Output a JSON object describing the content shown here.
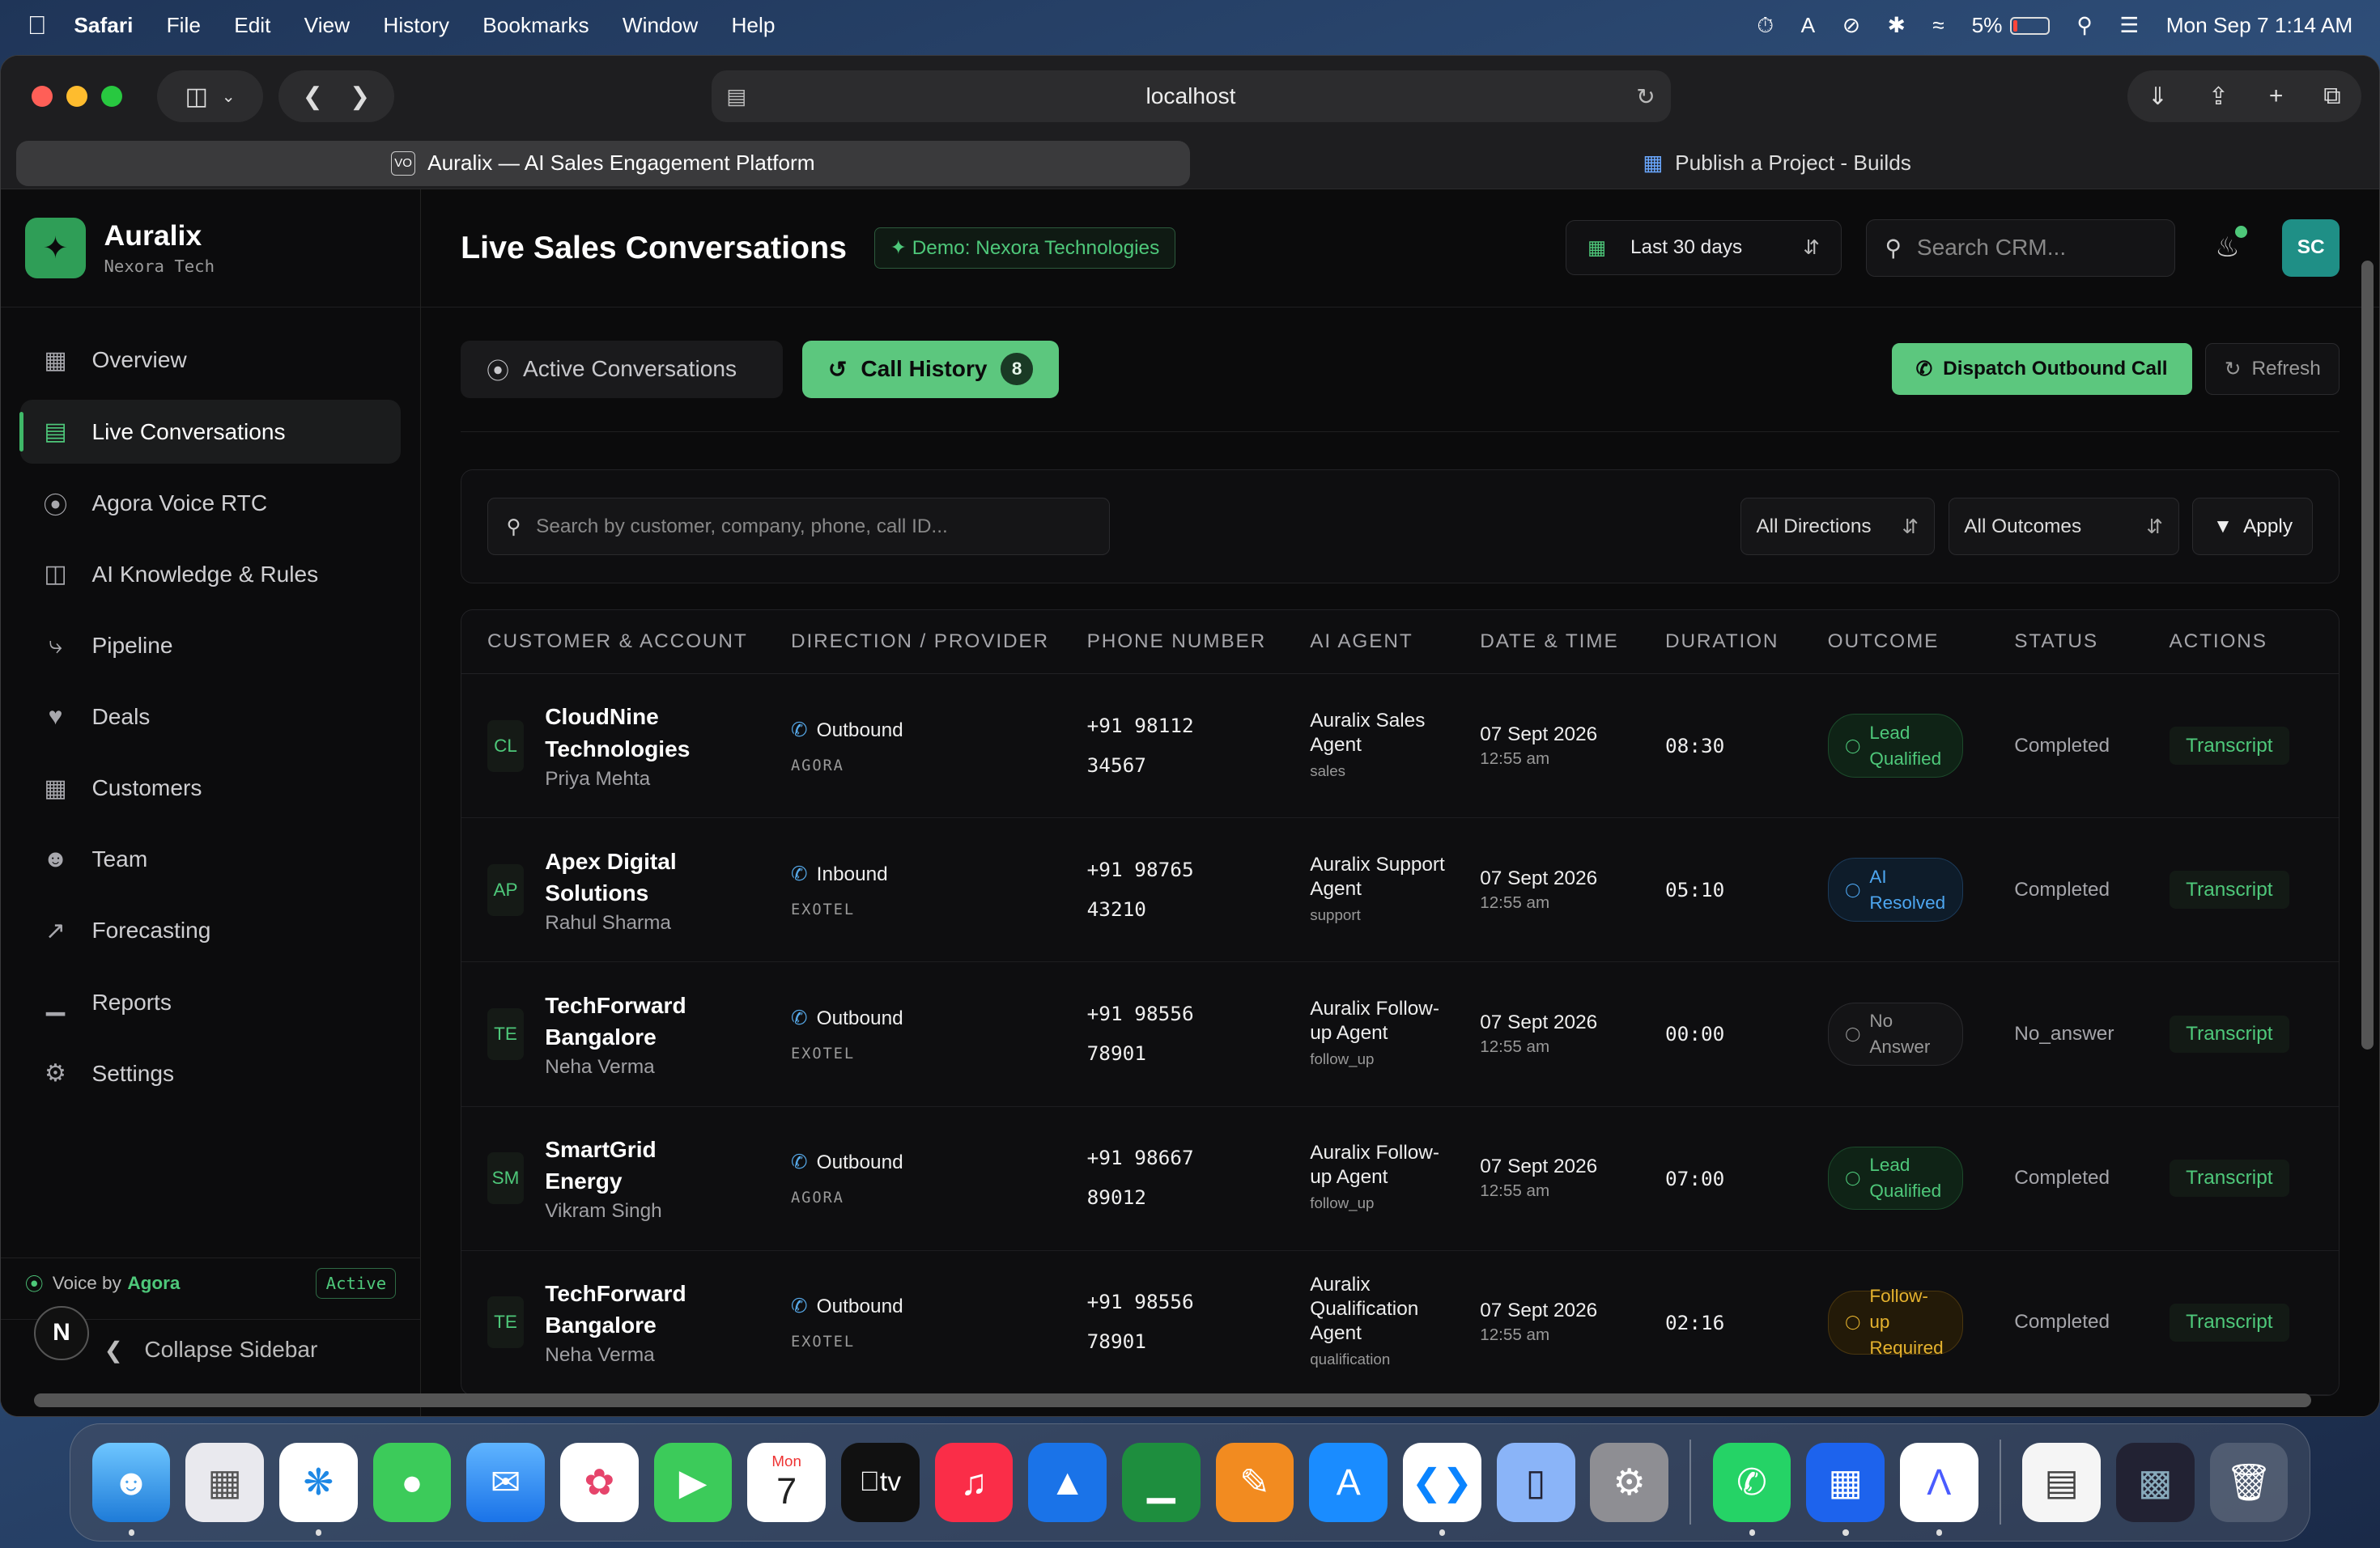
{
  "menubar": {
    "apple": "",
    "items": [
      "Safari",
      "File",
      "Edit",
      "View",
      "History",
      "Bookmarks",
      "Window",
      "Help"
    ],
    "battery": "5%",
    "datetime": "Mon Sep 7  1:14 AM"
  },
  "browser": {
    "url": "localhost",
    "tabs": [
      {
        "label": "Auralix — AI Sales Engagement Platform",
        "icon": "auralix-favicon"
      },
      {
        "label": "Publish a Project - Builds",
        "icon": "builds-favicon"
      }
    ]
  },
  "brand": {
    "name": "Auralix",
    "subtitle": "Nexora Tech",
    "icon": "sparkle-icon"
  },
  "sidebar": {
    "items": [
      {
        "label": "Overview",
        "icon": "grid-icon"
      },
      {
        "label": "Live Conversations",
        "icon": "chat-icon"
      },
      {
        "label": "Agora Voice RTC",
        "icon": "broadcast-icon"
      },
      {
        "label": "AI Knowledge & Rules",
        "icon": "book-icon"
      },
      {
        "label": "Pipeline",
        "icon": "pipeline-icon"
      },
      {
        "label": "Deals",
        "icon": "handshake-icon"
      },
      {
        "label": "Customers",
        "icon": "building-icon"
      },
      {
        "label": "Team",
        "icon": "users-icon"
      },
      {
        "label": "Forecasting",
        "icon": "trend-icon"
      },
      {
        "label": "Reports",
        "icon": "bar-chart-icon"
      },
      {
        "label": "Settings",
        "icon": "gear-icon"
      }
    ],
    "active_index": 1,
    "voice_label": "Voice by",
    "voice_provider": "Agora",
    "voice_status": "Active",
    "collapse_label": "Collapse Sidebar",
    "avatar_letter": "N"
  },
  "header": {
    "title": "Live Sales Conversations",
    "demo_badge": "Demo: Nexora Technologies",
    "date_range": "Last 30 days",
    "search_placeholder": "Search CRM...",
    "user_initials": "SC"
  },
  "toolbar": {
    "tab_active_conversations": "Active Conversations",
    "tab_call_history": "Call History",
    "call_history_count": "8",
    "dispatch_label": "Dispatch Outbound Call",
    "refresh_label": "Refresh"
  },
  "filters": {
    "search_placeholder": "Search by customer, company, phone, call ID...",
    "direction": "All Directions",
    "outcome": "All Outcomes",
    "apply": "Apply"
  },
  "table": {
    "headers": [
      "CUSTOMER & ACCOUNT",
      "DIRECTION / PROVIDER",
      "PHONE NUMBER",
      "AI AGENT",
      "DATE & TIME",
      "DURATION",
      "OUTCOME",
      "STATUS",
      "ACTIONS"
    ],
    "rows": [
      {
        "initials": "CL",
        "company": "CloudNine Technologies",
        "person": "Priya Mehta",
        "direction": "Outbound",
        "provider": "AGORA",
        "phone": "+91 98112 34567",
        "agent": "Auralix Sales Agent",
        "agent_key": "sales",
        "date": "07 Sept 2026",
        "time": "12:55 am",
        "duration": "08:30",
        "outcome": "Lead Qualified",
        "outcome_tone": "green",
        "status": "Completed",
        "action": "Transcript"
      },
      {
        "initials": "AP",
        "company": "Apex Digital Solutions",
        "person": "Rahul Sharma",
        "direction": "Inbound",
        "provider": "EXOTEL",
        "phone": "+91 98765 43210",
        "agent": "Auralix Support Agent",
        "agent_key": "support",
        "date": "07 Sept 2026",
        "time": "12:55 am",
        "duration": "05:10",
        "outcome": "AI Resolved",
        "outcome_tone": "blue",
        "status": "Completed",
        "action": "Transcript"
      },
      {
        "initials": "TE",
        "company": "TechForward Bangalore",
        "person": "Neha Verma",
        "direction": "Outbound",
        "provider": "EXOTEL",
        "phone": "+91 98556 78901",
        "agent": "Auralix Follow-up Agent",
        "agent_key": "follow_up",
        "date": "07 Sept 2026",
        "time": "12:55 am",
        "duration": "00:00",
        "outcome": "No Answer",
        "outcome_tone": "grey",
        "status": "No_answer",
        "action": "Transcript"
      },
      {
        "initials": "SM",
        "company": "SmartGrid Energy",
        "person": "Vikram Singh",
        "direction": "Outbound",
        "provider": "AGORA",
        "phone": "+91 98667 89012",
        "agent": "Auralix Follow-up Agent",
        "agent_key": "follow_up",
        "date": "07 Sept 2026",
        "time": "12:55 am",
        "duration": "07:00",
        "outcome": "Lead Qualified",
        "outcome_tone": "green",
        "status": "Completed",
        "action": "Transcript"
      },
      {
        "initials": "TE",
        "company": "TechForward Bangalore",
        "person": "Neha Verma",
        "direction": "Outbound",
        "provider": "EXOTEL",
        "phone": "+91 98556 78901",
        "agent": "Auralix Qualification Agent",
        "agent_key": "qualification",
        "date": "07 Sept 2026",
        "time": "12:55 am",
        "duration": "02:16",
        "outcome": "Follow-up Required",
        "outcome_tone": "amber",
        "status": "Completed",
        "action": "Transcript"
      }
    ]
  },
  "dock": {
    "apps": [
      "Finder",
      "Launchpad",
      "Safari",
      "Messages",
      "Mail",
      "Photos",
      "FaceTime",
      "Calendar",
      "TV",
      "Music",
      "Keynote",
      "Numbers",
      "Pages",
      "App Store",
      "VS Code",
      "Simulator",
      "System Settings",
      "WhatsApp",
      "Docker",
      "Arc",
      "Document",
      "Screenshot",
      "Trash"
    ],
    "calendar_month": "Mon",
    "calendar_day": "7",
    "tv_label": "tv"
  },
  "colors": {
    "accent": "#5cc77e",
    "outbound_blue": "#56a8e8"
  }
}
